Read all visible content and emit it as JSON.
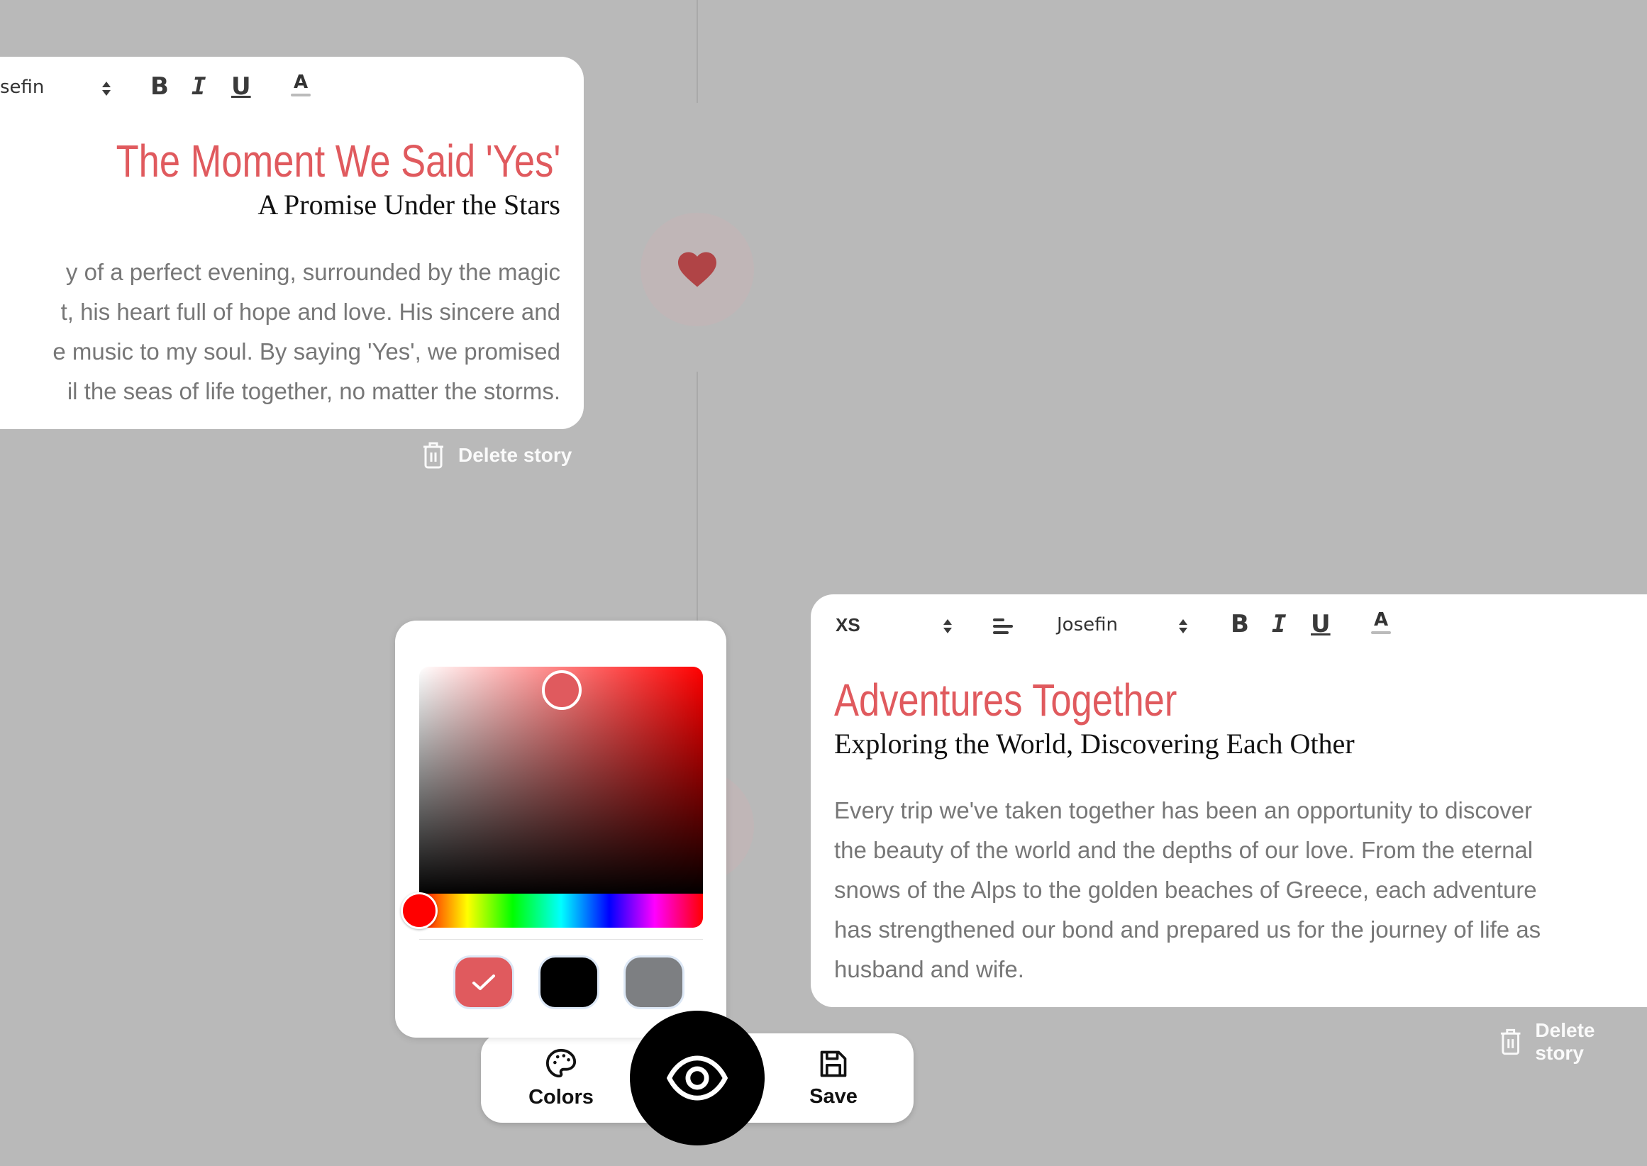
{
  "colors": {
    "background": "#b9b9b9",
    "accent": "#e05a5e",
    "heart": "#b04446"
  },
  "stories": [
    {
      "toolbar": {
        "font_family": "Josefin",
        "font_family_visible": "sefin",
        "bold": "B",
        "italic": "I",
        "underline": "U",
        "text_color": "A"
      },
      "title": "The Moment We Said 'Yes'",
      "subtitle": "A Promise Under the Stars",
      "body_lines": [
        "y of a perfect evening, surrounded by the magic",
        "t, his heart full of hope and love. His sincere and",
        "e music to my soul. By saying 'Yes', we promised",
        "il the seas of life together, no matter the storms."
      ],
      "delete_label": "Delete story",
      "alignment": "right"
    },
    {
      "toolbar": {
        "size": "XS",
        "align_icon": "align-left-icon",
        "font_family": "Josefin",
        "bold": "B",
        "italic": "I",
        "underline": "U",
        "text_color": "A"
      },
      "title": "Adventures Together",
      "subtitle": "Exploring the World, Discovering Each Other",
      "body_lines": [
        "Every trip we've taken together has been an opportunity to discover",
        "the beauty of the world and the depths of our love. From the eternal",
        "snows of the Alps to the golden beaches of Greece, each adventure",
        "has strengthened our bond and prepared us for the journey of life as",
        "husband and wife."
      ],
      "delete_label": "Delete story",
      "alignment": "left"
    }
  ],
  "timeline": {
    "marker_icon": "heart-icon"
  },
  "color_picker": {
    "selected_color": "#e05a5e",
    "hue_color": "#ff0000",
    "swatches": [
      {
        "color": "#e05a5e",
        "selected": true
      },
      {
        "color": "#000000",
        "selected": false
      },
      {
        "color": "#7d7f82",
        "selected": false
      }
    ]
  },
  "bottom_bar": {
    "colors_label": "Colors",
    "colors_icon": "palette-icon",
    "preview_icon": "eye-icon",
    "save_label": "Save",
    "save_icon": "floppy-disk-icon"
  }
}
